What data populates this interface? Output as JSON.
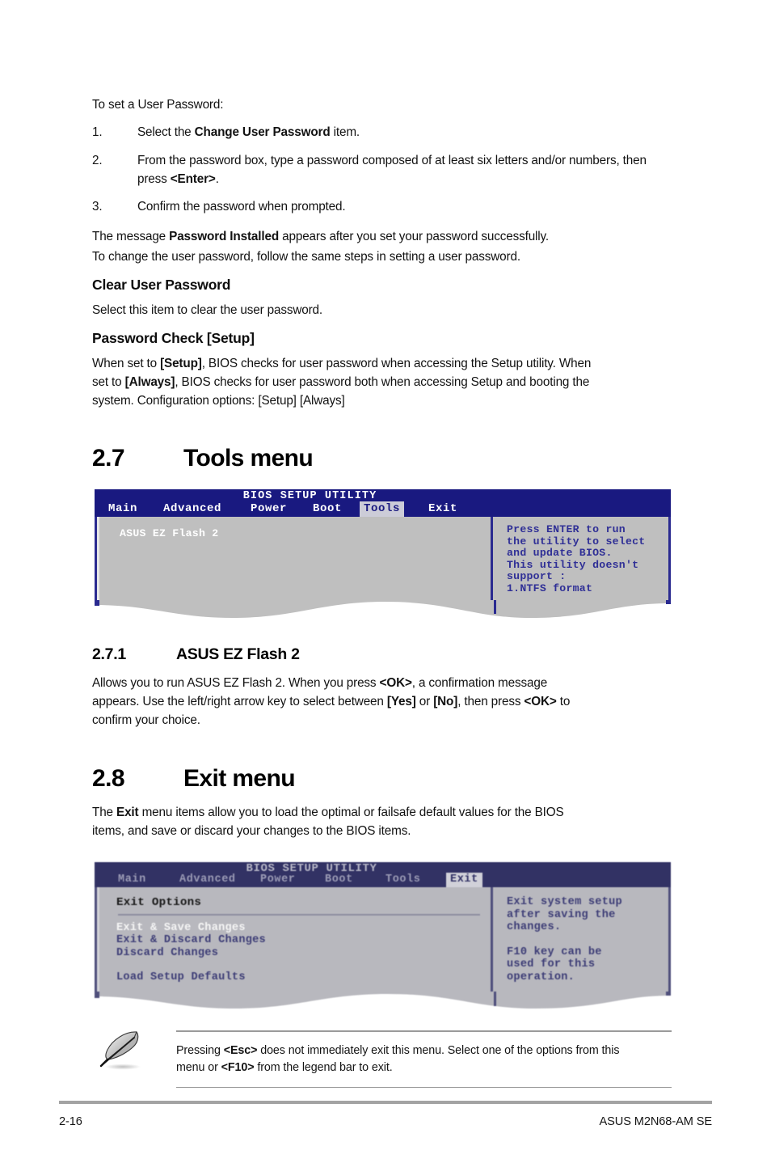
{
  "page": {
    "number": "2-16",
    "product": "ASUS M2N68-AM SE"
  },
  "user_password": {
    "intro": "To set a User Password:",
    "steps": [
      {
        "num": "1.",
        "pre": "Select the ",
        "bold": "Change User Password",
        "post": " item."
      },
      {
        "num": "2.",
        "pre": "From the password box, type a password composed of at least six letters and/or numbers, then press ",
        "bold": "<Enter>",
        "post": "."
      },
      {
        "num": "3.",
        "pre": "Confirm the password when prompted.",
        "bold": "",
        "post": ""
      }
    ],
    "message_pre": "The message ",
    "message_bold": "Password Installed",
    "message_post": " appears after you set your password successfully.",
    "change_note": "To change the user password, follow the same steps in setting a user password."
  },
  "clear_user_password": {
    "heading": "Clear User Password",
    "body": "Select this item to clear the user password."
  },
  "password_check": {
    "heading": "Password Check [Setup]",
    "line1_pre": "When set to ",
    "line1_bold": "[Setup]",
    "line1_post": ", BIOS checks for user password when accessing the Setup utility. When",
    "line2_pre": "set to ",
    "line2_bold": "[Always]",
    "line2_post": ", BIOS checks for user password both when accessing Setup and booting the",
    "line3": "system. Configuration options: [Setup] [Always]"
  },
  "tools_menu": {
    "chapter_num": "2.7",
    "chapter_title": "Tools menu",
    "bios": {
      "title": "BIOS SETUP UTILITY",
      "tabs": [
        {
          "label": "Main",
          "active": false
        },
        {
          "label": "Advanced",
          "active": false
        },
        {
          "label": "Power",
          "active": false
        },
        {
          "label": "Boot",
          "active": false
        },
        {
          "label": "Tools",
          "active": true
        },
        {
          "label": "Exit",
          "active": false
        }
      ],
      "items": [
        {
          "label": "ASUS EZ Flash 2",
          "style": "white"
        }
      ],
      "help": [
        "Press ENTER to run",
        "the utility to select",
        "and update BIOS.",
        "This utility doesn't",
        "support :",
        "1.NTFS format"
      ]
    }
  },
  "ez_flash": {
    "section_num": "2.7.1",
    "section_title": "ASUS EZ Flash 2",
    "line1_pre": "Allows you to run ASUS EZ Flash 2. When you press ",
    "line1_bold": "<OK>",
    "line1_post": ", a confirmation message",
    "line2_pre": "appears. Use the left/right arrow key to select between ",
    "line2_bold1": "[Yes]",
    "line2_mid": " or ",
    "line2_bold2": "[No]",
    "line2_mid2": ", then press ",
    "line2_bold3": "<OK>",
    "line2_post": " to",
    "line3": "confirm your choice."
  },
  "exit_menu": {
    "chapter_num": "2.8",
    "chapter_title": "Exit menu",
    "intro_pre": "The ",
    "intro_bold": "Exit",
    "intro_post": " menu items allow you to load the optimal or failsafe default values for the BIOS",
    "intro_line2": "items, and save or discard your changes to the BIOS items.",
    "bios": {
      "title": "BIOS SETUP UTILITY",
      "tabs": [
        {
          "label": "Main",
          "active": false
        },
        {
          "label": "Advanced",
          "active": false
        },
        {
          "label": "Power",
          "active": false
        },
        {
          "label": "Boot",
          "active": false
        },
        {
          "label": "Tools",
          "active": false
        },
        {
          "label": "Exit",
          "active": true
        }
      ],
      "group_heading": "Exit Options",
      "items": [
        {
          "label": "Exit & Save Changes",
          "style": "white"
        },
        {
          "label": "Exit & Discard Changes",
          "style": "blue"
        },
        {
          "label": "Discard Changes",
          "style": "blue"
        },
        {
          "label": "Load Setup Defaults",
          "style": "blue"
        }
      ],
      "help": [
        "Exit system setup",
        "after saving the",
        "changes.",
        "",
        "F10 key can be",
        "used for this",
        "operation."
      ]
    }
  },
  "note": {
    "icon": "quill-pen-icon",
    "line1_pre": "Pressing ",
    "line1_bold": "<Esc>",
    "line1_post": " does not immediately exit this menu. Select one of the options from this",
    "line2_pre": "menu or ",
    "line2_bold": "<F10>",
    "line2_post": " from the legend bar to exit."
  },
  "colors": {
    "bios_header_blue": "#191980",
    "bios_body_gray": "#bfbfbf",
    "bios_border_blue": "#2a2a90",
    "bios_text_blue": "#2f2f96",
    "tab_active_bg": "#ccccd8",
    "footer_rule": "#a3a3a3"
  }
}
